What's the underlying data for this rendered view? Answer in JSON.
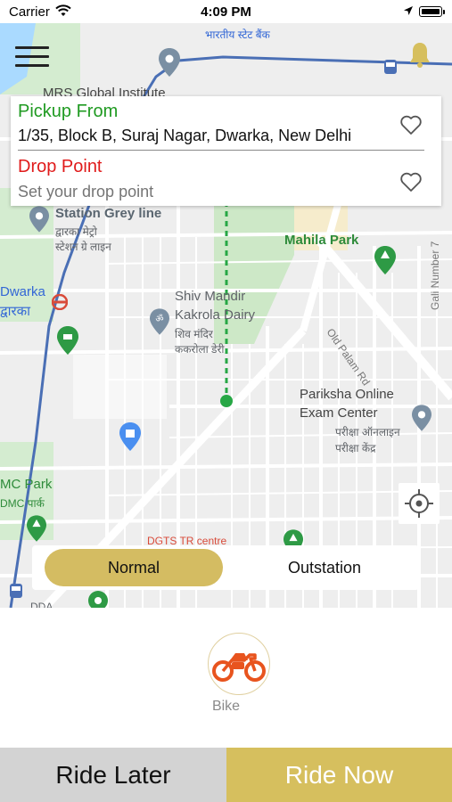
{
  "status_bar": {
    "carrier": "Carrier",
    "time": "4:09 PM"
  },
  "map": {
    "labels": {
      "bank": "भारतीय स्टेट बैंक",
      "institute": "MRS Global Institute",
      "station": "Station Grey line",
      "station_hindi_1": "द्वारका मेट्रो",
      "station_hindi_2": "स्टेशन ग्रे लाइन",
      "mahila_park": "Mahila Park",
      "dwarka": "Dwarka",
      "dwarka_hindi": "द्वारका",
      "shiv_mandir_1": "Shiv Mandir",
      "shiv_mandir_2": "Kakrola Dairy",
      "shiv_mandir_hindi_1": "शिव मंदिर",
      "shiv_mandir_hindi_2": "ककरोला डेरी",
      "old_palam_rd": "Old Palam Rd",
      "gali": "Gali Number 7",
      "pariksha_1": "Pariksha Online",
      "pariksha_2": "Exam Center",
      "pariksha_hindi_1": "परीक्षा ऑनलाइन",
      "pariksha_hindi_2": "परीक्षा केंद्र",
      "dmc_park": "MC Park",
      "dmc_park_hindi": "DMC पार्क",
      "dda": "DDA",
      "dgts": "DGTS TR centre"
    }
  },
  "location_card": {
    "pickup_label": "Pickup From",
    "pickup_address": "1/35, Block B, Suraj Nagar, Dwarka, New Delhi",
    "drop_label": "Drop Point",
    "drop_placeholder": "Set your drop point"
  },
  "ride_type": {
    "normal": "Normal",
    "outstation": "Outstation",
    "selected": "Normal"
  },
  "vehicle": {
    "label": "Bike",
    "icon": "motorcycle-icon",
    "color": "#e8541e"
  },
  "actions": {
    "ride_later": "Ride Later",
    "ride_now": "Ride Now"
  },
  "colors": {
    "accent": "#d6bf5e",
    "pickup": "#1f9a21",
    "drop": "#e01b1b"
  }
}
